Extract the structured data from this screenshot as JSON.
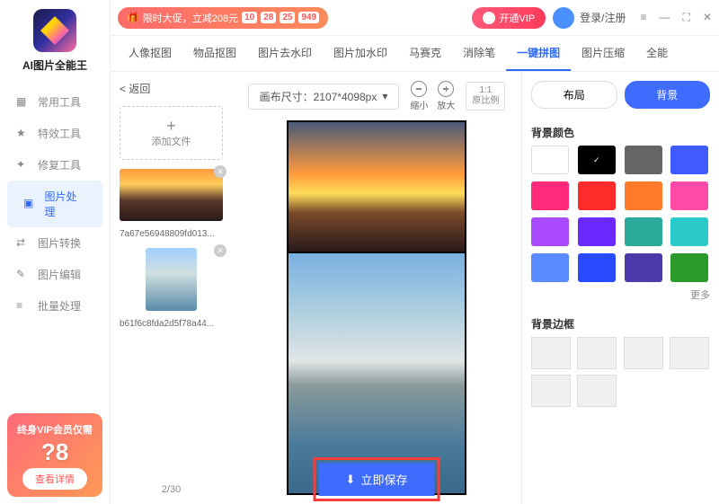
{
  "app": {
    "name": "AI图片全能王"
  },
  "top": {
    "sale_text": "限时大促，立减208元",
    "countdown": [
      "10",
      "28",
      "25",
      "949"
    ],
    "vip": "开通VIP",
    "login": "登录/注册"
  },
  "sidebar": {
    "items": [
      {
        "label": "常用工具"
      },
      {
        "label": "特效工具"
      },
      {
        "label": "修复工具"
      },
      {
        "label": "图片处理"
      },
      {
        "label": "图片转换"
      },
      {
        "label": "图片编辑"
      },
      {
        "label": "批量处理"
      }
    ]
  },
  "promo": {
    "line1": "终身VIP会员仅需",
    "price": "?8",
    "btn": "查看详情"
  },
  "tabs": [
    "人像抠图",
    "物品抠图",
    "图片去水印",
    "图片加水印",
    "马赛克",
    "消除笔",
    "一键拼图",
    "图片压缩",
    "全能"
  ],
  "active_tab": "一键拼图",
  "left": {
    "back": "< 返回",
    "add": "添加文件",
    "files": [
      {
        "name": "7a67e56948809fd013..."
      },
      {
        "name": "b61f6c8fda2d5f78a44..."
      }
    ],
    "pager": "2/30"
  },
  "center": {
    "canvas_label": "画布尺寸：2107*4098px",
    "zoom_out": "缩小",
    "zoom_in": "放大",
    "ratio1": "1:1",
    "ratio2": "原比例",
    "save": "立即保存"
  },
  "right": {
    "mode_layout": "布局",
    "mode_bg": "背景",
    "color_title": "背景颜色",
    "colors": [
      {
        "c": "#ffffff",
        "white": true
      },
      {
        "c": "#000000",
        "sel": true
      },
      {
        "c": "#666666"
      },
      {
        "c": "#3f5bff"
      },
      {
        "c": "#ff2a7a"
      },
      {
        "c": "#ff2a2a"
      },
      {
        "c": "#ff7a2a"
      },
      {
        "c": "#ff4aaa"
      },
      {
        "c": "#aa4aff"
      },
      {
        "c": "#6a2aff"
      },
      {
        "c": "#2aaa9a"
      },
      {
        "c": "#2acaca"
      },
      {
        "c": "#5a8aff"
      },
      {
        "c": "#2a4aff"
      },
      {
        "c": "#4a3aaa"
      },
      {
        "c": "#2a9a2a"
      }
    ],
    "more": "更多",
    "border_title": "背景边框"
  }
}
